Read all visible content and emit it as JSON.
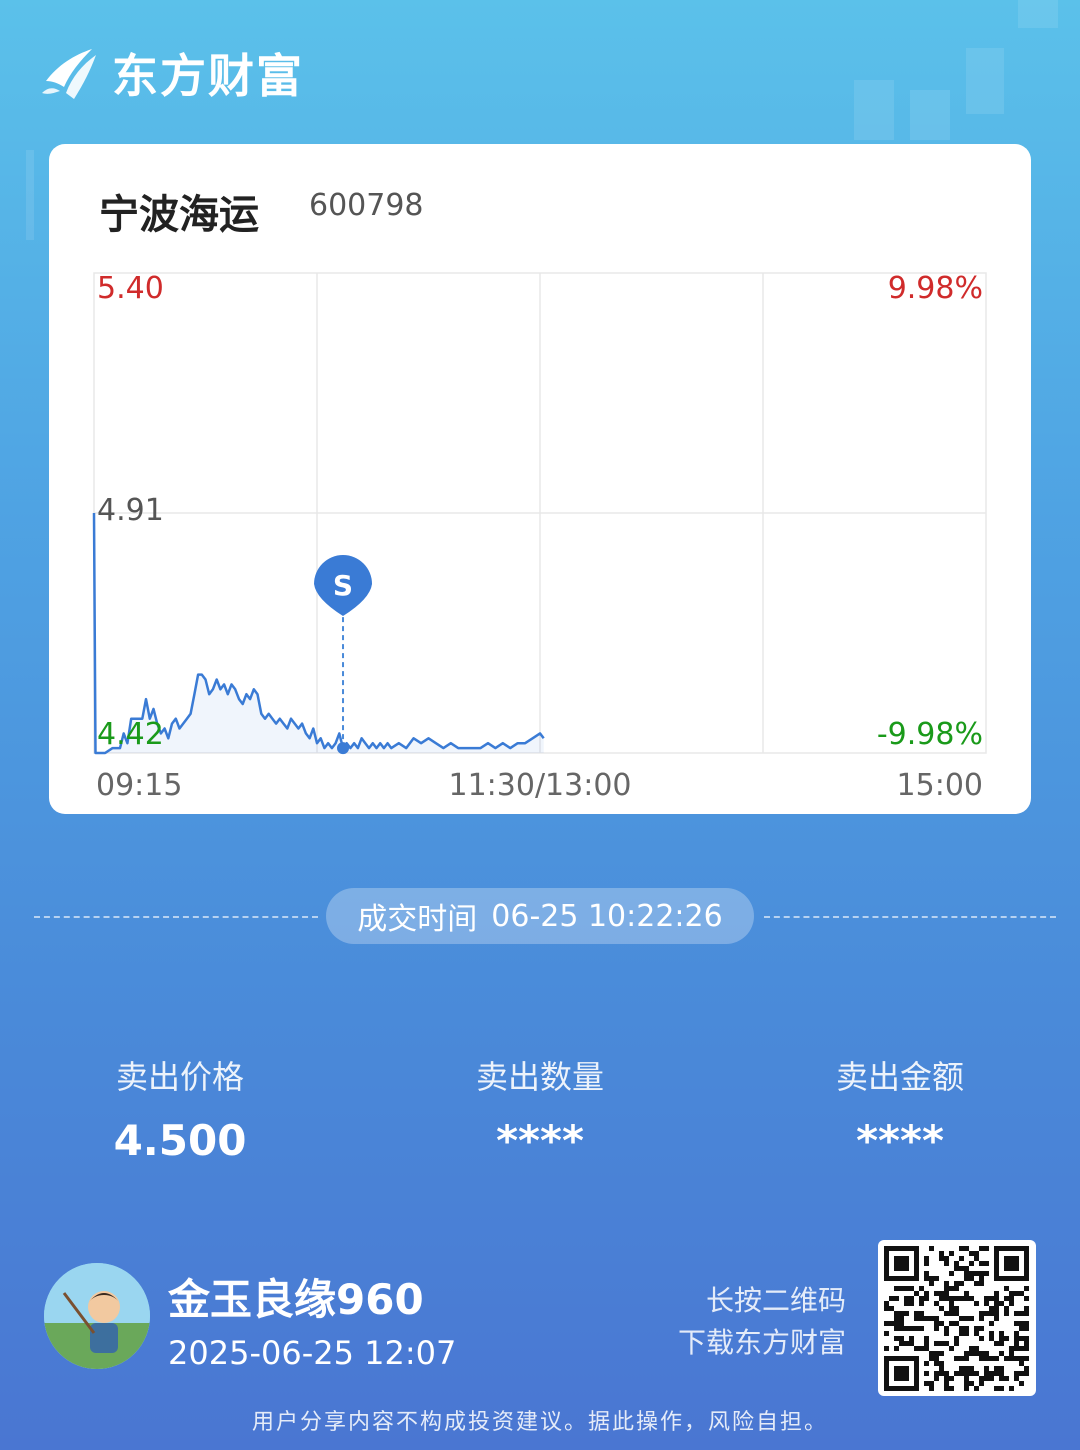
{
  "brand": {
    "name": "东方财富"
  },
  "stock": {
    "name": "宁波海运",
    "code": "600798"
  },
  "chart_data": {
    "type": "line",
    "y_labels": {
      "top": "5.40",
      "mid": "4.91",
      "bottom": "4.42"
    },
    "pct_labels": {
      "top": "9.98%",
      "bottom": "-9.98%"
    },
    "x_labels": {
      "start": "09:15",
      "mid": "11:30/13:00",
      "end": "15:00"
    },
    "ylim": [
      4.42,
      5.4
    ],
    "prev_close": 4.91,
    "x_minutes_total": 240,
    "price_path": [
      [
        0,
        4.91
      ],
      [
        0.4,
        4.42
      ],
      [
        3,
        4.42
      ],
      [
        5,
        4.43
      ],
      [
        7,
        4.43
      ],
      [
        8,
        4.46
      ],
      [
        9,
        4.44
      ],
      [
        10,
        4.49
      ],
      [
        13,
        4.49
      ],
      [
        14,
        4.53
      ],
      [
        15,
        4.49
      ],
      [
        16,
        4.51
      ],
      [
        17,
        4.48
      ],
      [
        18,
        4.46
      ],
      [
        19,
        4.47
      ],
      [
        20,
        4.45
      ],
      [
        21,
        4.48
      ],
      [
        22,
        4.49
      ],
      [
        23,
        4.47
      ],
      [
        24,
        4.48
      ],
      [
        25,
        4.49
      ],
      [
        26,
        4.5
      ],
      [
        27,
        4.54
      ],
      [
        28,
        4.58
      ],
      [
        29,
        4.58
      ],
      [
        30,
        4.57
      ],
      [
        31,
        4.54
      ],
      [
        32,
        4.55
      ],
      [
        33,
        4.57
      ],
      [
        34,
        4.55
      ],
      [
        35,
        4.56
      ],
      [
        36,
        4.54
      ],
      [
        37,
        4.56
      ],
      [
        38,
        4.55
      ],
      [
        39,
        4.53
      ],
      [
        40,
        4.52
      ],
      [
        41,
        4.54
      ],
      [
        42,
        4.53
      ],
      [
        43,
        4.55
      ],
      [
        44,
        4.54
      ],
      [
        45,
        4.5
      ],
      [
        46,
        4.49
      ],
      [
        47,
        4.5
      ],
      [
        48,
        4.49
      ],
      [
        49,
        4.48
      ],
      [
        50,
        4.49
      ],
      [
        51,
        4.48
      ],
      [
        52,
        4.47
      ],
      [
        53,
        4.49
      ],
      [
        54,
        4.48
      ],
      [
        55,
        4.47
      ],
      [
        56,
        4.48
      ],
      [
        57,
        4.46
      ],
      [
        58,
        4.45
      ],
      [
        59,
        4.47
      ],
      [
        60,
        4.44
      ],
      [
        61,
        4.45
      ],
      [
        62,
        4.43
      ],
      [
        63,
        4.44
      ],
      [
        64,
        4.43
      ],
      [
        65,
        4.44
      ],
      [
        66,
        4.46
      ],
      [
        67,
        4.43
      ],
      [
        68,
        4.44
      ],
      [
        69,
        4.43
      ],
      [
        70,
        4.44
      ],
      [
        71,
        4.43
      ],
      [
        72,
        4.45
      ],
      [
        73,
        4.44
      ],
      [
        74,
        4.43
      ],
      [
        75,
        4.44
      ],
      [
        76,
        4.43
      ],
      [
        77,
        4.44
      ],
      [
        78,
        4.43
      ],
      [
        79,
        4.44
      ],
      [
        80,
        4.43
      ],
      [
        82,
        4.44
      ],
      [
        84,
        4.43
      ],
      [
        86,
        4.45
      ],
      [
        88,
        4.44
      ],
      [
        90,
        4.45
      ],
      [
        92,
        4.44
      ],
      [
        94,
        4.43
      ],
      [
        96,
        4.44
      ],
      [
        98,
        4.43
      ],
      [
        100,
        4.43
      ],
      [
        104,
        4.43
      ],
      [
        106,
        4.44
      ],
      [
        108,
        4.43
      ],
      [
        110,
        4.44
      ],
      [
        112,
        4.43
      ],
      [
        114,
        4.44
      ],
      [
        116,
        4.44
      ],
      [
        118,
        4.45
      ],
      [
        120,
        4.46
      ],
      [
        121,
        4.45
      ]
    ],
    "marker": {
      "label": "S",
      "minute": 67
    }
  },
  "trade": {
    "time_label": "成交时间",
    "time_value": "06-25 10:22:26"
  },
  "stats": [
    {
      "label": "卖出价格",
      "value": "4.500"
    },
    {
      "label": "卖出数量",
      "value": "****"
    },
    {
      "label": "卖出金额",
      "value": "****"
    }
  ],
  "user": {
    "name": "金玉良缘960",
    "time": "2025-06-25 12:07"
  },
  "qr_hint": {
    "line1": "长按二维码",
    "line2": "下载东方财富"
  },
  "disclaimer": "用户分享内容不构成投资建议。据此操作，风险自担。",
  "colors": {
    "up": "#d02b2b",
    "down": "#1a9a1a",
    "line": "#3a7bd5",
    "grid": "#e8e8e8"
  }
}
